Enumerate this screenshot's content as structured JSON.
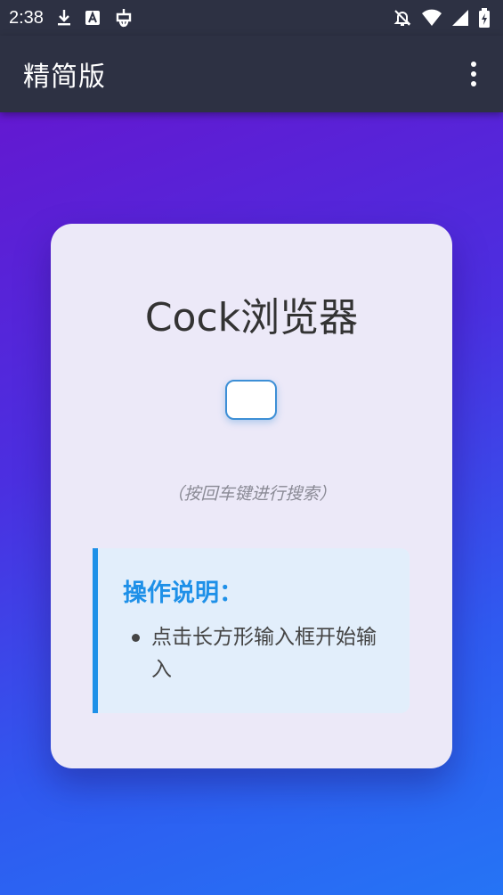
{
  "status_bar": {
    "time": "2:38",
    "left_icons": [
      "download-icon",
      "a-notification-icon",
      "bug-icon"
    ],
    "right_icons": [
      "bell-off-icon",
      "wifi-icon",
      "signal-icon",
      "battery-charging-icon"
    ]
  },
  "app_bar": {
    "title": "精简版",
    "menu_icon": "more-vert-icon"
  },
  "card": {
    "title": "Cock浏览器",
    "search_value": "",
    "hint": "（按回车键进行搜索）",
    "instructions": {
      "heading": "操作说明：",
      "items": [
        "点击长方形输入框开始输入"
      ]
    }
  },
  "colors": {
    "accent": "#1e90e8",
    "bar": "#2d3143",
    "gradient_start": "#6a12cc",
    "gradient_end": "#2574f5"
  }
}
